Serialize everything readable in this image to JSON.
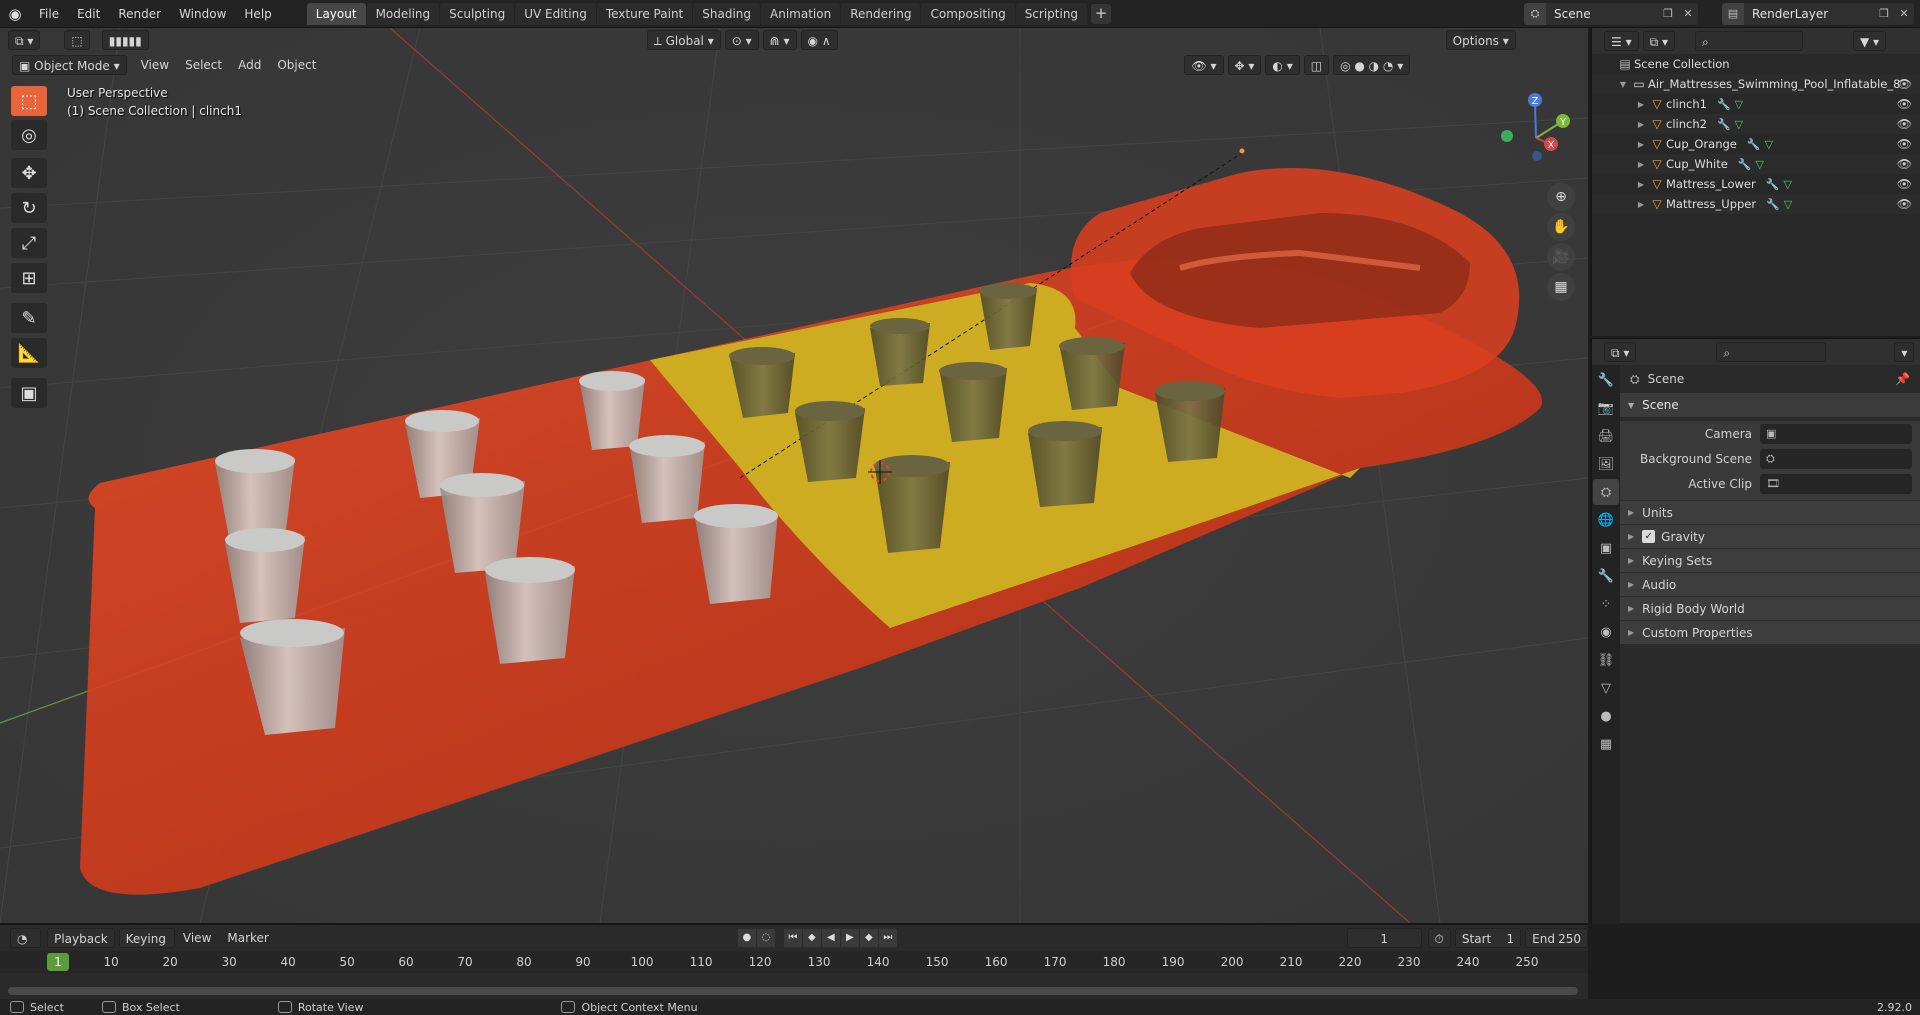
{
  "menu": [
    "File",
    "Edit",
    "Render",
    "Window",
    "Help"
  ],
  "workspaces": [
    "Layout",
    "Modeling",
    "Sculpting",
    "UV Editing",
    "Texture Paint",
    "Shading",
    "Animation",
    "Rendering",
    "Compositing",
    "Scripting"
  ],
  "active_workspace": "Layout",
  "scene_field": "Scene",
  "renderlayer_field": "RenderLayer",
  "viewport": {
    "mode": "Object Mode",
    "menus": [
      "View",
      "Select",
      "Add",
      "Object"
    ],
    "transform_orientation": "Global",
    "options_label": "Options",
    "perspective_label": "User Perspective",
    "collection_label": "(1) Scene Collection | clinch1",
    "gizmo_axes": [
      "X",
      "Y",
      "Z"
    ]
  },
  "outliner": {
    "root": "Scene Collection",
    "collection": "Air_Mattresses_Swimming_Pool_Inflatable_8",
    "objects": [
      "clinch1",
      "clinch2",
      "Cup_Orange",
      "Cup_White",
      "Mattress_Lower",
      "Mattress_Upper"
    ]
  },
  "properties": {
    "context": "Scene",
    "panel": "Scene",
    "fields": [
      {
        "label": "Camera",
        "value": ""
      },
      {
        "label": "Background Scene",
        "value": ""
      },
      {
        "label": "Active Clip",
        "value": ""
      }
    ],
    "subpanels": [
      "Units",
      "Gravity",
      "Keying Sets",
      "Audio",
      "Rigid Body World",
      "Custom Properties"
    ]
  },
  "timeline": {
    "menus": [
      "Playback",
      "Keying",
      "View",
      "Marker"
    ],
    "current_frame": "1",
    "start_label": "Start",
    "start": "1",
    "end_label": "End",
    "end": "250",
    "ticks": [
      "1",
      "10",
      "20",
      "30",
      "40",
      "50",
      "60",
      "70",
      "80",
      "90",
      "100",
      "110",
      "120",
      "130",
      "140",
      "150",
      "160",
      "170",
      "180",
      "190",
      "200",
      "210",
      "220",
      "230",
      "240",
      "250"
    ]
  },
  "statusbar": {
    "select": "Select",
    "box_select": "Box Select",
    "rotate": "Rotate View",
    "context_menu": "Object Context Menu",
    "version": "2.92.0"
  },
  "colors": {
    "accent": "#e8643a",
    "mattress_red": "#d9321a",
    "mattress_yellow": "#d8c020",
    "object_icon": "#e89a3c"
  }
}
